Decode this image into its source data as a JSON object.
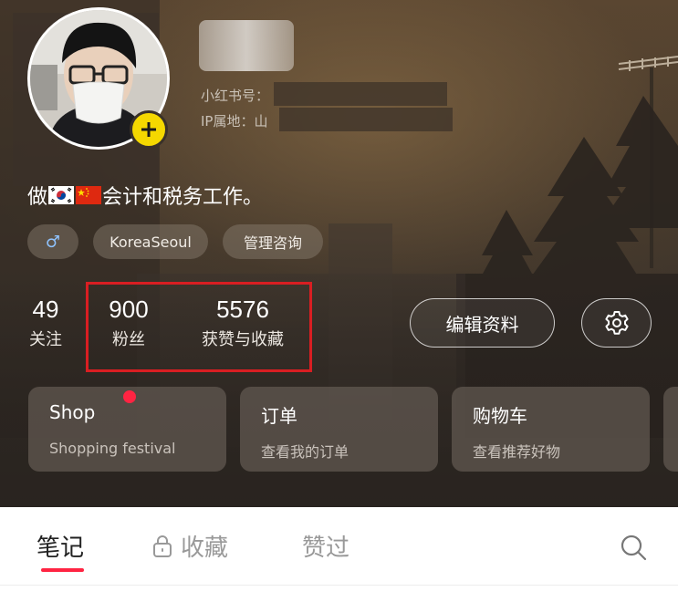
{
  "profile": {
    "meta_line_1": "小红书号：",
    "meta_line_2": "IP属地：山",
    "bio": {
      "prefix": "做",
      "suffix": "会计和税务工作。",
      "flags": [
        "korea-flag",
        "china-flag"
      ]
    },
    "tags": [
      {
        "label": "♂",
        "icon": "male-icon"
      },
      {
        "label": "KoreaSeoul"
      },
      {
        "label": "管理咨询"
      }
    ]
  },
  "stats": {
    "following": {
      "value": "49",
      "label": "关注"
    },
    "followers": {
      "value": "900",
      "label": "粉丝"
    },
    "likes": {
      "value": "5576",
      "label": "获赞与收藏"
    }
  },
  "actions": {
    "edit_label": "编辑资料",
    "settings_icon": "gear-icon"
  },
  "cards": [
    {
      "title": "Shop",
      "subtitle": "Shopping festival",
      "has_dot": true
    },
    {
      "title": "订单",
      "subtitle": "查看我的订单"
    },
    {
      "title": "购物车",
      "subtitle": "查看推荐好物"
    }
  ],
  "tabs": [
    {
      "label": "笔记",
      "active": true
    },
    {
      "label": "收藏",
      "icon": "lock-icon"
    },
    {
      "label": "赞过"
    }
  ],
  "colors": {
    "accent": "#ff2442",
    "highlight_box": "#d91e22",
    "add_badge": "#f5d800"
  }
}
